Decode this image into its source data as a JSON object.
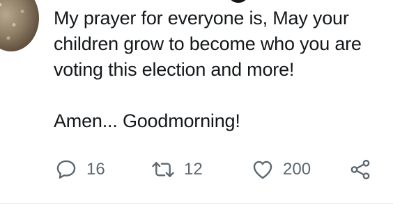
{
  "tweet": {
    "lines": [
      "My prayer for everyone is, May your",
      "children grow to become who you are",
      "voting this election and more!",
      "Amen... Goodmorning!"
    ]
  },
  "actions": {
    "reply": {
      "icon": "reply-icon",
      "count": "16"
    },
    "retweet": {
      "icon": "retweet-icon",
      "count": "12"
    },
    "like": {
      "icon": "heart-icon",
      "count": "200"
    },
    "share": {
      "icon": "share-icon"
    }
  },
  "colors": {
    "text": "#14171a",
    "icon": "#5b6770",
    "divider": "#e1e8ed"
  }
}
